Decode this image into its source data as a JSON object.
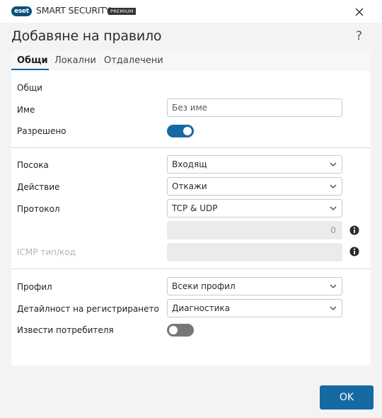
{
  "titlebar": {
    "logo_text": "eset",
    "product_name": "SMART SECURITY",
    "edition": "PREMIUM"
  },
  "header": {
    "title": "Добавяне на правило",
    "help_label": "?"
  },
  "tabs": [
    {
      "label": "Общи",
      "active": true
    },
    {
      "label": "Локални",
      "active": false
    },
    {
      "label": "Отдалечени",
      "active": false
    }
  ],
  "general": {
    "section_title": "Общи",
    "name_label": "Име",
    "name_value": "Без име",
    "enabled_label": "Разрешено",
    "enabled": true
  },
  "rule": {
    "direction_label": "Посока",
    "direction_value": "Входящ",
    "action_label": "Действие",
    "action_value": "Откажи",
    "protocol_label": "Протокол",
    "protocol_value": "TCP & UDP",
    "protocol_number": "0",
    "icmp_label": "ICMP тип/код",
    "icmp_value": ""
  },
  "profile": {
    "profile_label": "Профил",
    "profile_value": "Всеки профил",
    "logging_label": "Детайлност на регистрирането",
    "logging_value": "Диагностика",
    "notify_label": "Извести потребителя",
    "notify": false
  },
  "footer": {
    "ok_label": "OK"
  },
  "colors": {
    "accent": "#156aa3",
    "toggle_off": "#777777",
    "logo": "#0d4f7a"
  }
}
